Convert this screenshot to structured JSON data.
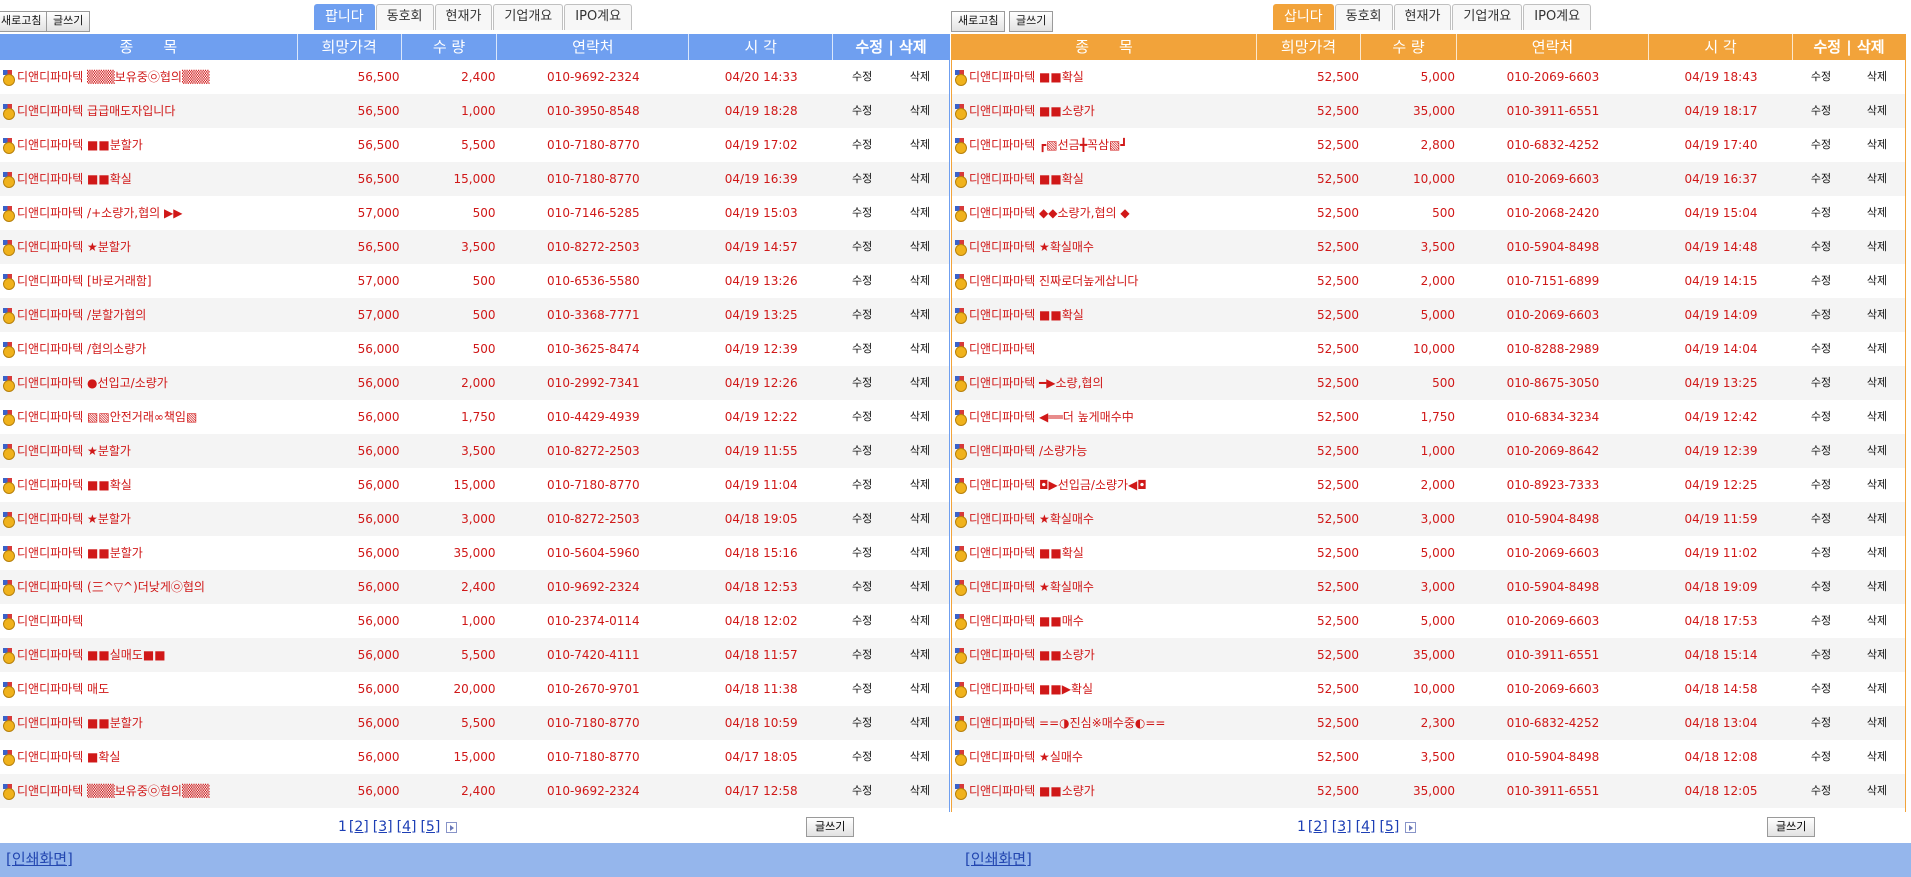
{
  "sell": {
    "refresh_label": "새로고침",
    "write_label": "글쓰기",
    "tabs": [
      {
        "label": "팝니다",
        "active": true
      },
      {
        "label": "동호회",
        "active": false
      },
      {
        "label": "현재가",
        "active": false
      },
      {
        "label": "기업개요",
        "active": false
      },
      {
        "label": "IPO계요",
        "active": false
      }
    ],
    "headers": {
      "title": "종　　목",
      "price": "희망가격",
      "qty": "수 량",
      "phone": "연락처",
      "time": "시 각",
      "action": "수정 | 삭제"
    },
    "edit_label": "수정",
    "delete_label": "삭제",
    "rows": [
      {
        "title": "디앤디파마텍 ▒▒▒보유중㉧협의▒▒▒",
        "price": "56,500",
        "qty": "2,400",
        "phone": "010-9692-2324",
        "time": "04/20 14:33"
      },
      {
        "title": "디앤디파마텍 급급매도자입니다",
        "price": "56,500",
        "qty": "1,000",
        "phone": "010-3950-8548",
        "time": "04/19 18:28"
      },
      {
        "title": "디앤디파마텍 ■■분할가",
        "price": "56,500",
        "qty": "5,500",
        "phone": "010-7180-8770",
        "time": "04/19 17:02"
      },
      {
        "title": "디앤디파마텍 ■■확실",
        "price": "56,500",
        "qty": "15,000",
        "phone": "010-7180-8770",
        "time": "04/19 16:39"
      },
      {
        "title": "디앤디파마텍 /+소량가,협의 ▶▶",
        "price": "57,000",
        "qty": "500",
        "phone": "010-7146-5285",
        "time": "04/19 15:03"
      },
      {
        "title": "디앤디파마텍 ★분할가",
        "price": "56,500",
        "qty": "3,500",
        "phone": "010-8272-2503",
        "time": "04/19 14:57"
      },
      {
        "title": "디앤디파마텍 [바로거래함]",
        "price": "57,000",
        "qty": "500",
        "phone": "010-6536-5580",
        "time": "04/19 13:26"
      },
      {
        "title": "디앤디파마텍 /분할가협의",
        "price": "57,000",
        "qty": "500",
        "phone": "010-3368-7771",
        "time": "04/19 13:25"
      },
      {
        "title": "디앤디파마텍 /협의소량가",
        "price": "56,000",
        "qty": "500",
        "phone": "010-3625-8474",
        "time": "04/19 12:39"
      },
      {
        "title": "디앤디파마텍 ●선입고/소량가",
        "price": "56,000",
        "qty": "2,000",
        "phone": "010-2992-7341",
        "time": "04/19 12:26"
      },
      {
        "title": "디앤디파마텍 ▧▧안전거래∞책임▧",
        "price": "56,000",
        "qty": "1,750",
        "phone": "010-4429-4939",
        "time": "04/19 12:22"
      },
      {
        "title": "디앤디파마텍 ★분할가",
        "price": "56,000",
        "qty": "3,500",
        "phone": "010-8272-2503",
        "time": "04/19 11:55"
      },
      {
        "title": "디앤디파마텍 ■■확실",
        "price": "56,000",
        "qty": "15,000",
        "phone": "010-7180-8770",
        "time": "04/19 11:04"
      },
      {
        "title": "디앤디파마텍 ★분할가",
        "price": "56,000",
        "qty": "3,000",
        "phone": "010-8272-2503",
        "time": "04/18 19:05"
      },
      {
        "title": "디앤디파마텍 ■■분할가",
        "price": "56,000",
        "qty": "35,000",
        "phone": "010-5604-5960",
        "time": "04/18 15:16"
      },
      {
        "title": "디앤디파마텍 (三^▽^)더낮게㉧협의",
        "price": "56,000",
        "qty": "2,400",
        "phone": "010-9692-2324",
        "time": "04/18 12:53"
      },
      {
        "title": "디앤디파마텍",
        "price": "56,000",
        "qty": "1,000",
        "phone": "010-2374-0114",
        "time": "04/18 12:02"
      },
      {
        "title": "디앤디파마텍 ■■실매도■■",
        "price": "56,000",
        "qty": "5,500",
        "phone": "010-7420-4111",
        "time": "04/18 11:57"
      },
      {
        "title": "디앤디파마텍 매도",
        "price": "56,000",
        "qty": "20,000",
        "phone": "010-2670-9701",
        "time": "04/18 11:38"
      },
      {
        "title": "디앤디파마텍 ■■분할가",
        "price": "56,000",
        "qty": "5,500",
        "phone": "010-7180-8770",
        "time": "04/18 10:59"
      },
      {
        "title": "디앤디파마텍 ■확실",
        "price": "56,000",
        "qty": "15,000",
        "phone": "010-7180-8770",
        "time": "04/17 18:05"
      },
      {
        "title": "디앤디파마텍 ▒▒▒보유중㉧협의▒▒▒",
        "price": "56,000",
        "qty": "2,400",
        "phone": "010-9692-2324",
        "time": "04/17 12:58"
      }
    ],
    "pager": {
      "current": "1",
      "pages": [
        "[2]",
        "[3]",
        "[4]",
        "[5]"
      ]
    },
    "bottom_write_label": "글쓰기",
    "print_label": "[인쇄화면]"
  },
  "buy": {
    "refresh_label": "새로고침",
    "write_label": "글쓰기",
    "tabs": [
      {
        "label": "삽니다",
        "active": true
      },
      {
        "label": "동호회",
        "active": false
      },
      {
        "label": "현재가",
        "active": false
      },
      {
        "label": "기업개요",
        "active": false
      },
      {
        "label": "IPO계요",
        "active": false
      }
    ],
    "headers": {
      "title": "종　　목",
      "price": "희망가격",
      "qty": "수 량",
      "phone": "연락처",
      "time": "시 각",
      "action": "수정 | 삭제"
    },
    "edit_label": "수정",
    "delete_label": "삭제",
    "rows": [
      {
        "title": "디앤디파마텍 ■■확실",
        "price": "52,500",
        "qty": "5,000",
        "phone": "010-2069-6603",
        "time": "04/19 18:43"
      },
      {
        "title": "디앤디파마텍 ■■소량가",
        "price": "52,500",
        "qty": "35,000",
        "phone": "010-3911-6551",
        "time": "04/19 18:17"
      },
      {
        "title": "디앤디파마텍 ┏▧선금╋꼭삼▧┛",
        "price": "52,500",
        "qty": "2,800",
        "phone": "010-6832-4252",
        "time": "04/19 17:40"
      },
      {
        "title": "디앤디파마텍 ■■확실",
        "price": "52,500",
        "qty": "10,000",
        "phone": "010-2069-6603",
        "time": "04/19 16:37"
      },
      {
        "title": "디앤디파마텍 ◆◆소량가,협의 ◆",
        "price": "52,500",
        "qty": "500",
        "phone": "010-2068-2420",
        "time": "04/19 15:04"
      },
      {
        "title": "디앤디파마텍 ★확실매수",
        "price": "52,500",
        "qty": "3,500",
        "phone": "010-5904-8498",
        "time": "04/19 14:48"
      },
      {
        "title": "디앤디파마텍 진짜로더높게삽니다",
        "price": "52,500",
        "qty": "2,000",
        "phone": "010-7151-6899",
        "time": "04/19 14:15"
      },
      {
        "title": "디앤디파마텍 ■■확실",
        "price": "52,500",
        "qty": "5,000",
        "phone": "010-2069-6603",
        "time": "04/19 14:09"
      },
      {
        "title": "디앤디파마텍",
        "price": "52,500",
        "qty": "10,000",
        "phone": "010-8288-2989",
        "time": "04/19 14:04"
      },
      {
        "title": "디앤디파마텍 ━▶소량,협의",
        "price": "52,500",
        "qty": "500",
        "phone": "010-8675-3050",
        "time": "04/19 13:25"
      },
      {
        "title": "디앤디파마텍 ◀══더 높게매수中",
        "price": "52,500",
        "qty": "1,750",
        "phone": "010-6834-3234",
        "time": "04/19 12:42"
      },
      {
        "title": "디앤디파마텍 /소량가능",
        "price": "52,500",
        "qty": "1,000",
        "phone": "010-2069-8642",
        "time": "04/19 12:39"
      },
      {
        "title": "디앤디파마텍 ◘▶선입금/소량가◀◘",
        "price": "52,500",
        "qty": "2,000",
        "phone": "010-8923-7333",
        "time": "04/19 12:25"
      },
      {
        "title": "디앤디파마텍 ★확실매수",
        "price": "52,500",
        "qty": "3,000",
        "phone": "010-5904-8498",
        "time": "04/19 11:59"
      },
      {
        "title": "디앤디파마텍 ■■확실",
        "price": "52,500",
        "qty": "5,000",
        "phone": "010-2069-6603",
        "time": "04/19 11:02"
      },
      {
        "title": "디앤디파마텍 ★확실매수",
        "price": "52,500",
        "qty": "3,000",
        "phone": "010-5904-8498",
        "time": "04/18 19:09"
      },
      {
        "title": "디앤디파마텍 ■■매수",
        "price": "52,500",
        "qty": "5,000",
        "phone": "010-2069-6603",
        "time": "04/18 17:53"
      },
      {
        "title": "디앤디파마텍 ■■소량가",
        "price": "52,500",
        "qty": "35,000",
        "phone": "010-3911-6551",
        "time": "04/18 15:14"
      },
      {
        "title": "디앤디파마텍 ■■▶확실",
        "price": "52,500",
        "qty": "10,000",
        "phone": "010-2069-6603",
        "time": "04/18 14:58"
      },
      {
        "title": "디앤디파마텍 ==◑진심※매수중◐==",
        "price": "52,500",
        "qty": "2,300",
        "phone": "010-6832-4252",
        "time": "04/18 13:04"
      },
      {
        "title": "디앤디파마텍 ★실매수",
        "price": "52,500",
        "qty": "3,500",
        "phone": "010-5904-8498",
        "time": "04/18 12:08"
      },
      {
        "title": "디앤디파마텍 ■■소량가",
        "price": "52,500",
        "qty": "35,000",
        "phone": "010-3911-6551",
        "time": "04/18 12:05"
      }
    ],
    "pager": {
      "current": "1",
      "pages": [
        "[2]",
        "[3]",
        "[4]",
        "[5]"
      ]
    },
    "bottom_write_label": "글쓰기",
    "print_label": "[인쇄화면]"
  },
  "colors": {
    "sell_accent": "#6f9ff0",
    "buy_accent": "#f2a33a",
    "text_red": "#d01818",
    "footer_bar": "#95b6ec"
  }
}
